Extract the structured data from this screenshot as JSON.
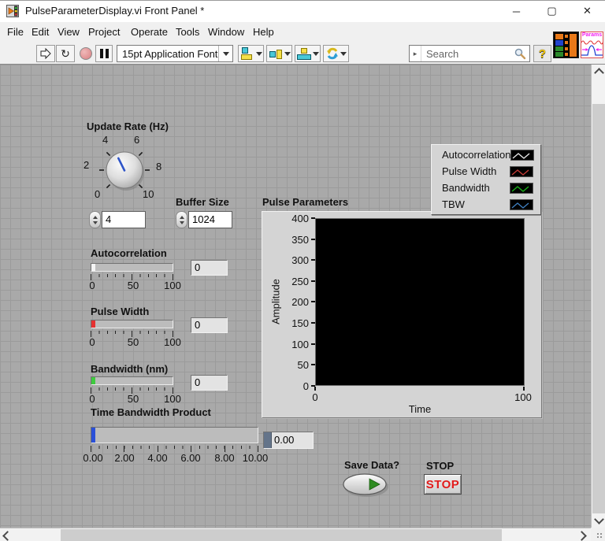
{
  "window": {
    "title": "PulseParameterDisplay.vi Front Panel *",
    "minimize": "─",
    "maximize": "▢",
    "close": "✕"
  },
  "menu": {
    "items": [
      "File",
      "Edit",
      "View",
      "Project",
      "Operate",
      "Tools",
      "Window",
      "Help"
    ]
  },
  "toolbar": {
    "font_selector": "15pt Application Font",
    "run_continuous_glyph": "↻",
    "search_placeholder": "Search",
    "search_pre_glyph": "▸",
    "help": "?",
    "vi_icon_label": "Params"
  },
  "controls": {
    "knob": {
      "label": "Update Rate (Hz)",
      "scale": [
        "0",
        "2",
        "4",
        "6",
        "8",
        "10"
      ],
      "value": "4",
      "needle_color": "#2f55c8"
    },
    "buffer": {
      "label": "Buffer Size",
      "value": "1024"
    },
    "sliders": [
      {
        "label": "Autocorrelation",
        "value": "0",
        "scale": [
          "0",
          "50",
          "100"
        ],
        "fill_color": "#f4f4f4"
      },
      {
        "label": "Pulse Width",
        "value": "0",
        "scale": [
          "0",
          "50",
          "100"
        ],
        "fill_color": "#e53030"
      },
      {
        "label": "Bandwidth (nm)",
        "value": "0",
        "scale": [
          "0",
          "50",
          "100"
        ],
        "fill_color": "#3ecb3e"
      }
    ],
    "tbw": {
      "label": "Time Bandwidth Product",
      "value": "0.00",
      "scale": [
        "0.00",
        "2.00",
        "4.00",
        "6.00",
        "8.00",
        "10.00"
      ],
      "fill_color": "#2a50d8"
    },
    "save": {
      "label": "Save Data?"
    },
    "stop": {
      "label": "STOP",
      "button_text": "STOP",
      "text_color": "#e21b1b"
    }
  },
  "chart_data": {
    "type": "line",
    "title": "Pulse Parameters",
    "xlabel": "Time",
    "ylabel": "Amplitude",
    "xlim": [
      0,
      100
    ],
    "ylim": [
      0,
      400
    ],
    "x_ticks": [
      "0",
      "100"
    ],
    "y_ticks": [
      "400",
      "350",
      "300",
      "250",
      "200",
      "150",
      "100",
      "50",
      "0"
    ],
    "plot_background": "#000000",
    "grid": false,
    "legend_position": "top-right",
    "legend": [
      {
        "label": "Autocorrelation",
        "color": "#e8e8e8"
      },
      {
        "label": "Pulse Width",
        "color": "#c23b36"
      },
      {
        "label": "Bandwidth",
        "color": "#19b219"
      },
      {
        "label": "TBW",
        "color": "#3f7fbf"
      }
    ],
    "series": [
      {
        "name": "Autocorrelation",
        "values": []
      },
      {
        "name": "Pulse Width",
        "values": []
      },
      {
        "name": "Bandwidth",
        "values": []
      },
      {
        "name": "TBW",
        "values": []
      }
    ]
  }
}
